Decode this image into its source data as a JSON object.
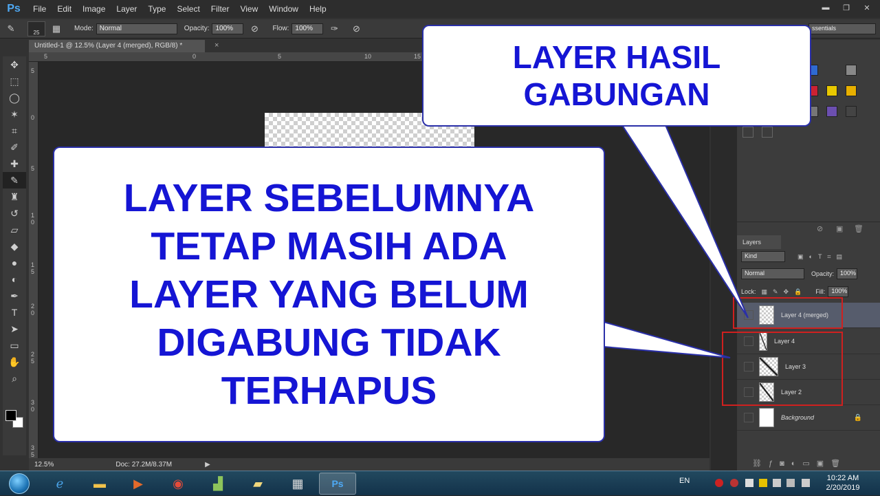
{
  "app": {
    "logo": "Ps",
    "menu": [
      "File",
      "Edit",
      "Image",
      "Layer",
      "Type",
      "Select",
      "Filter",
      "View",
      "Window",
      "Help"
    ],
    "window_controls": [
      "▬",
      "❐",
      "✕"
    ]
  },
  "options_bar": {
    "brush_size": "25",
    "mode_label": "Mode:",
    "mode_value": "Normal",
    "opacity_label": "Opacity:",
    "opacity_value": "100%",
    "flow_label": "Flow:",
    "flow_value": "100%",
    "workspace_value": "ssentials"
  },
  "document": {
    "tab_title": "Untitled-1 @ 12.5% (Layer 4 (merged), RGB/8) *",
    "close": "×"
  },
  "ruler": {
    "top": [
      "5",
      "0",
      "5",
      "10",
      "15"
    ],
    "left": [
      "5",
      "0",
      "5",
      "1 0",
      "1 5",
      "2 0",
      "2 5",
      "3 0",
      "3 5"
    ]
  },
  "status": {
    "zoom": "12.5%",
    "doc_size": "Doc: 27.2M/8.37M"
  },
  "layers_panel": {
    "tab": "Layers",
    "kind": "Kind",
    "blend": "Normal",
    "opacity_label": "Opacity:",
    "opacity_value": "100%",
    "lock_label": "Lock:",
    "fill_label": "Fill:",
    "fill_value": "100%",
    "layers": [
      {
        "name": "Layer 4 (merged)",
        "selected": true
      },
      {
        "name": "Layer 4",
        "selected": false
      },
      {
        "name": "Layer 3",
        "selected": false
      },
      {
        "name": "Layer 2",
        "selected": false
      },
      {
        "name": "Background",
        "selected": false
      }
    ]
  },
  "callouts": {
    "top_lines": [
      "LAYER HASIL",
      "GABUNGAN"
    ],
    "main_lines": [
      "LAYER SEBELUMNYA",
      "TETAP MASIH ADA",
      "LAYER YANG BELUM",
      "DIGABUNG TIDAK",
      "TERHAPUS"
    ]
  },
  "taskbar": {
    "lang": "EN",
    "time": "10:22 AM",
    "date": "2/20/2019"
  },
  "colors": {
    "callout_text": "#1515d4",
    "callout_border": "#2a2fa8",
    "highlight_box": "#d0201f"
  }
}
